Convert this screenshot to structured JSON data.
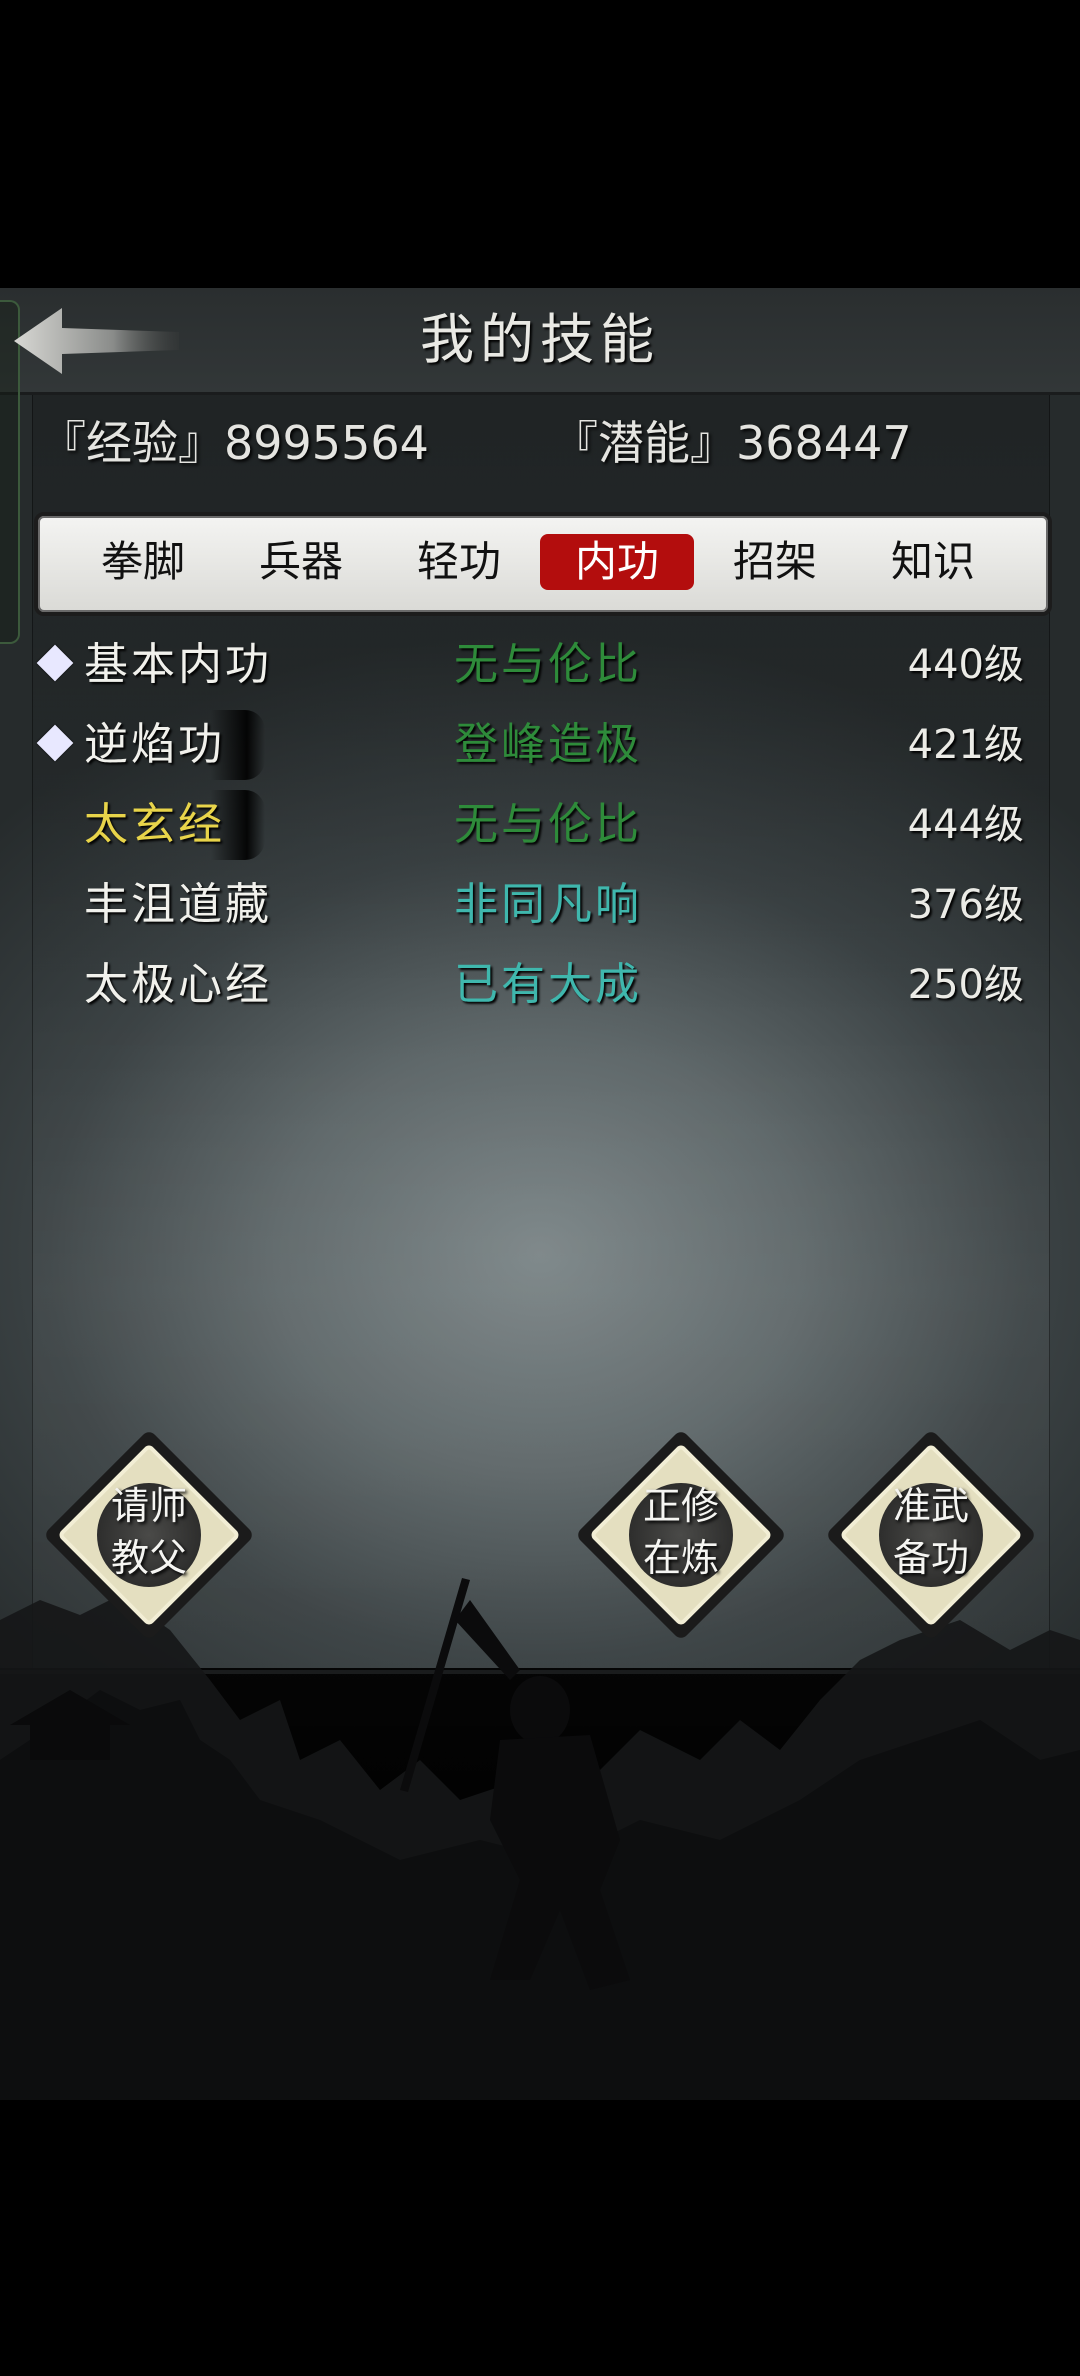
{
  "header": {
    "title": "我的技能",
    "back_icon": "back-arrow-icon"
  },
  "stats": {
    "exp_label": "『经验』8995564",
    "potential_label": "『潜能』368447"
  },
  "tabs": [
    {
      "label": "拳脚",
      "active": false
    },
    {
      "label": "兵器",
      "active": false
    },
    {
      "label": "轻功",
      "active": false
    },
    {
      "label": "内功",
      "active": true
    },
    {
      "label": "招架",
      "active": false
    },
    {
      "label": "知识",
      "active": false
    }
  ],
  "skills": [
    {
      "name": "基本内功",
      "rank": "无与伦比",
      "level": "440级",
      "marked": true,
      "name_color": "#f1f1ec",
      "rank_color": "#2e8b3a"
    },
    {
      "name": "逆焰功",
      "rank": "登峰造极",
      "level": "421级",
      "marked": true,
      "name_color": "#f1f1ec",
      "rank_color": "#2e8b3a"
    },
    {
      "name": "太玄经",
      "rank": "无与伦比",
      "level": "444级",
      "marked": false,
      "name_color": "#e8d44a",
      "rank_color": "#2e8b3a"
    },
    {
      "name": "丰沮道藏",
      "rank": "非同凡响",
      "level": "376级",
      "marked": false,
      "name_color": "#f1f1ec",
      "rank_color": "#3fb7ad"
    },
    {
      "name": "太极心经",
      "rank": "已有大成",
      "level": "250级",
      "marked": false,
      "name_color": "#f1f1ec",
      "rank_color": "#3fb7ad"
    }
  ],
  "actions": [
    {
      "line1": "请师",
      "line2": "教父"
    },
    {
      "line1": "正修",
      "line2": "在炼"
    },
    {
      "line1": "准武",
      "line2": "备功"
    }
  ],
  "colors": {
    "active_tab": "#b30d0d",
    "button_face": "#e4dfc0"
  }
}
